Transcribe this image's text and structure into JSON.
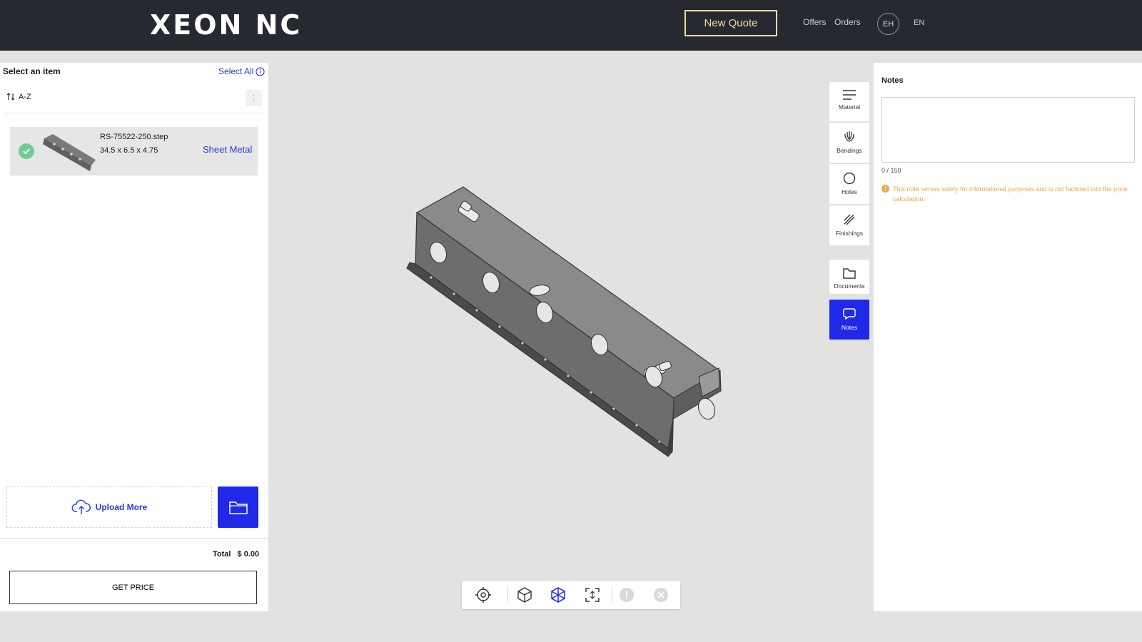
{
  "header": {
    "logo": "XEON NC",
    "new_quote": "New Quote",
    "offers": "Offers",
    "orders": "Orders",
    "avatar": "EH",
    "language": "EN"
  },
  "items_panel": {
    "title": "Select an item",
    "select_all": "Select All",
    "sort_label": "A-Z",
    "items": [
      {
        "name": "RS-75522-250.step",
        "dimensions": "34.5 x 6.5 x 4.75",
        "type": "Sheet Metal",
        "selected": true
      }
    ],
    "upload_more": "Upload More",
    "total_label": "Total",
    "total_value": "$ 0.00",
    "get_price": "GET PRICE"
  },
  "side_toolbar": {
    "items": [
      {
        "label": "Material",
        "icon": "material-icon"
      },
      {
        "label": "Bendings",
        "icon": "bendings-icon"
      },
      {
        "label": "Holes",
        "icon": "holes-icon"
      },
      {
        "label": "Finishings",
        "icon": "finishings-icon"
      },
      {
        "label": "Documents",
        "icon": "folder-icon"
      },
      {
        "label": "Notes",
        "icon": "chat-icon",
        "active": true
      }
    ]
  },
  "notes": {
    "title": "Notes",
    "value": "",
    "counter": "0 / 150",
    "warning": "This note serves solely for informational purposes and is not factored into the price calculation."
  },
  "viewer_toolbar": {
    "icons": [
      "target-icon",
      "cube-views-icon",
      "wireframe-icon",
      "fit-view-icon",
      "warning-icon",
      "close-icon"
    ]
  },
  "colors": {
    "header_bg": "#262a30",
    "accent_blue": "#2029e8",
    "link_blue": "#2b3bd9",
    "quote_gold": "#f3d9a0",
    "warning_orange": "#f0a64a",
    "check_green": "#6fcd93"
  }
}
